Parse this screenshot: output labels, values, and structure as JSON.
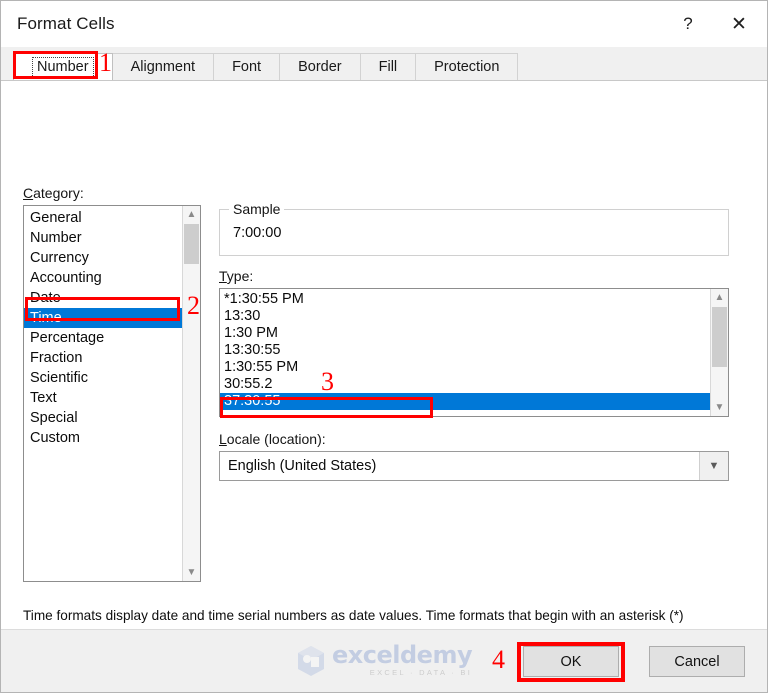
{
  "window": {
    "title": "Format Cells",
    "help_label": "?",
    "close_label": "✕"
  },
  "tabs": [
    {
      "label": "Number",
      "selected": true
    },
    {
      "label": "Alignment",
      "selected": false
    },
    {
      "label": "Font",
      "selected": false
    },
    {
      "label": "Border",
      "selected": false
    },
    {
      "label": "Fill",
      "selected": false
    },
    {
      "label": "Protection",
      "selected": false
    }
  ],
  "category": {
    "label": "Category:",
    "items": [
      "General",
      "Number",
      "Currency",
      "Accounting",
      "Date",
      "Time",
      "Percentage",
      "Fraction",
      "Scientific",
      "Text",
      "Special",
      "Custom"
    ],
    "selected": "Time",
    "scroll_up_icon": "chevron-up-icon",
    "scroll_down_icon": "chevron-down-icon"
  },
  "sample": {
    "legend": "Sample",
    "value": "7:00:00"
  },
  "type": {
    "label": "Type:",
    "items": [
      "*1:30:55 PM",
      "13:30",
      "1:30 PM",
      "13:30:55",
      "1:30:55 PM",
      "30:55.2",
      "37:30:55"
    ],
    "selected": "37:30:55",
    "scroll_up_icon": "chevron-up-icon",
    "scroll_down_icon": "chevron-down-icon"
  },
  "locale": {
    "label": "Locale (location):",
    "value": "English (United States)",
    "dropdown_icon": "chevron-down-icon"
  },
  "description": "Time formats display date and time serial numbers as date values.  Time formats that begin with an asterisk (*) respond to changes in regional date and time settings that are specified for the operating system. Formats without an asterisk are not affected by operating system settings.",
  "footer": {
    "ok_label": "OK",
    "cancel_label": "Cancel"
  },
  "watermark": {
    "name": "exceldemy",
    "tagline": "EXCEL · DATA · BI"
  },
  "annotations": [
    {
      "id": "step-1",
      "text": "1",
      "target": "number-tab"
    },
    {
      "id": "step-2",
      "text": "2",
      "target": "category-time"
    },
    {
      "id": "step-3",
      "text": "3",
      "target": "type-37-30-55"
    },
    {
      "id": "step-4",
      "text": "4",
      "target": "ok-button"
    }
  ],
  "colors": {
    "selection_blue": "#0078D7",
    "annotation_red": "#FF0000",
    "dialog_bg": "#F0F0F0"
  }
}
